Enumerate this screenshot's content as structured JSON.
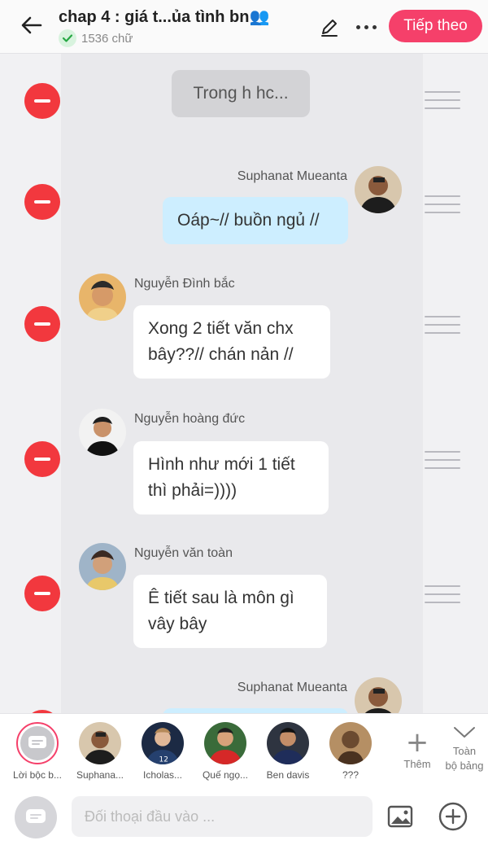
{
  "header": {
    "title": "chap 4 : giá t...ủa tình bn👥",
    "word_count": "1536 chữ",
    "next_label": "Tiếp theo",
    "accent_color": "#f5406a"
  },
  "messages": [
    {
      "type": "narration",
      "text": "Trong h hc..."
    },
    {
      "type": "right",
      "sender": "Suphanat Mueanta",
      "text": "Oáp~// buồn ngủ //"
    },
    {
      "type": "left",
      "sender": "Nguyễn Đình bắc",
      "text_line1": "Xong 2 tiết văn chx",
      "text_line2": "bây??// chán nản //"
    },
    {
      "type": "left",
      "sender": "Nguyễn hoàng đức",
      "text_line1": "Hình như mới 1 tiết",
      "text_line2": "thì phải=))))"
    },
    {
      "type": "left",
      "sender": "Nguyễn văn toàn",
      "text_line1": "Ê tiết sau là môn gì",
      "text_line2": "vây bây"
    },
    {
      "type": "right",
      "sender": "Suphanat Mueanta",
      "text": ""
    }
  ],
  "characters": [
    {
      "name": "Lời bộc b...",
      "icon": "narrator-icon"
    },
    {
      "name": "Suphana..."
    },
    {
      "name": "Icholas..."
    },
    {
      "name": "Quế ngọ..."
    },
    {
      "name": "Ben davis"
    },
    {
      "name": "???"
    }
  ],
  "add_character_label": "Thêm",
  "expand_all_label_line1": "Toàn",
  "expand_all_label_line2": "bộ bảng",
  "input": {
    "placeholder": "Đối thoại đầu vào ..."
  },
  "colors": {
    "delete": "#f2383e",
    "right_bubble": "#cdeeff",
    "left_bubble": "#ffffff",
    "narration_bubble": "#d3d3d6"
  }
}
